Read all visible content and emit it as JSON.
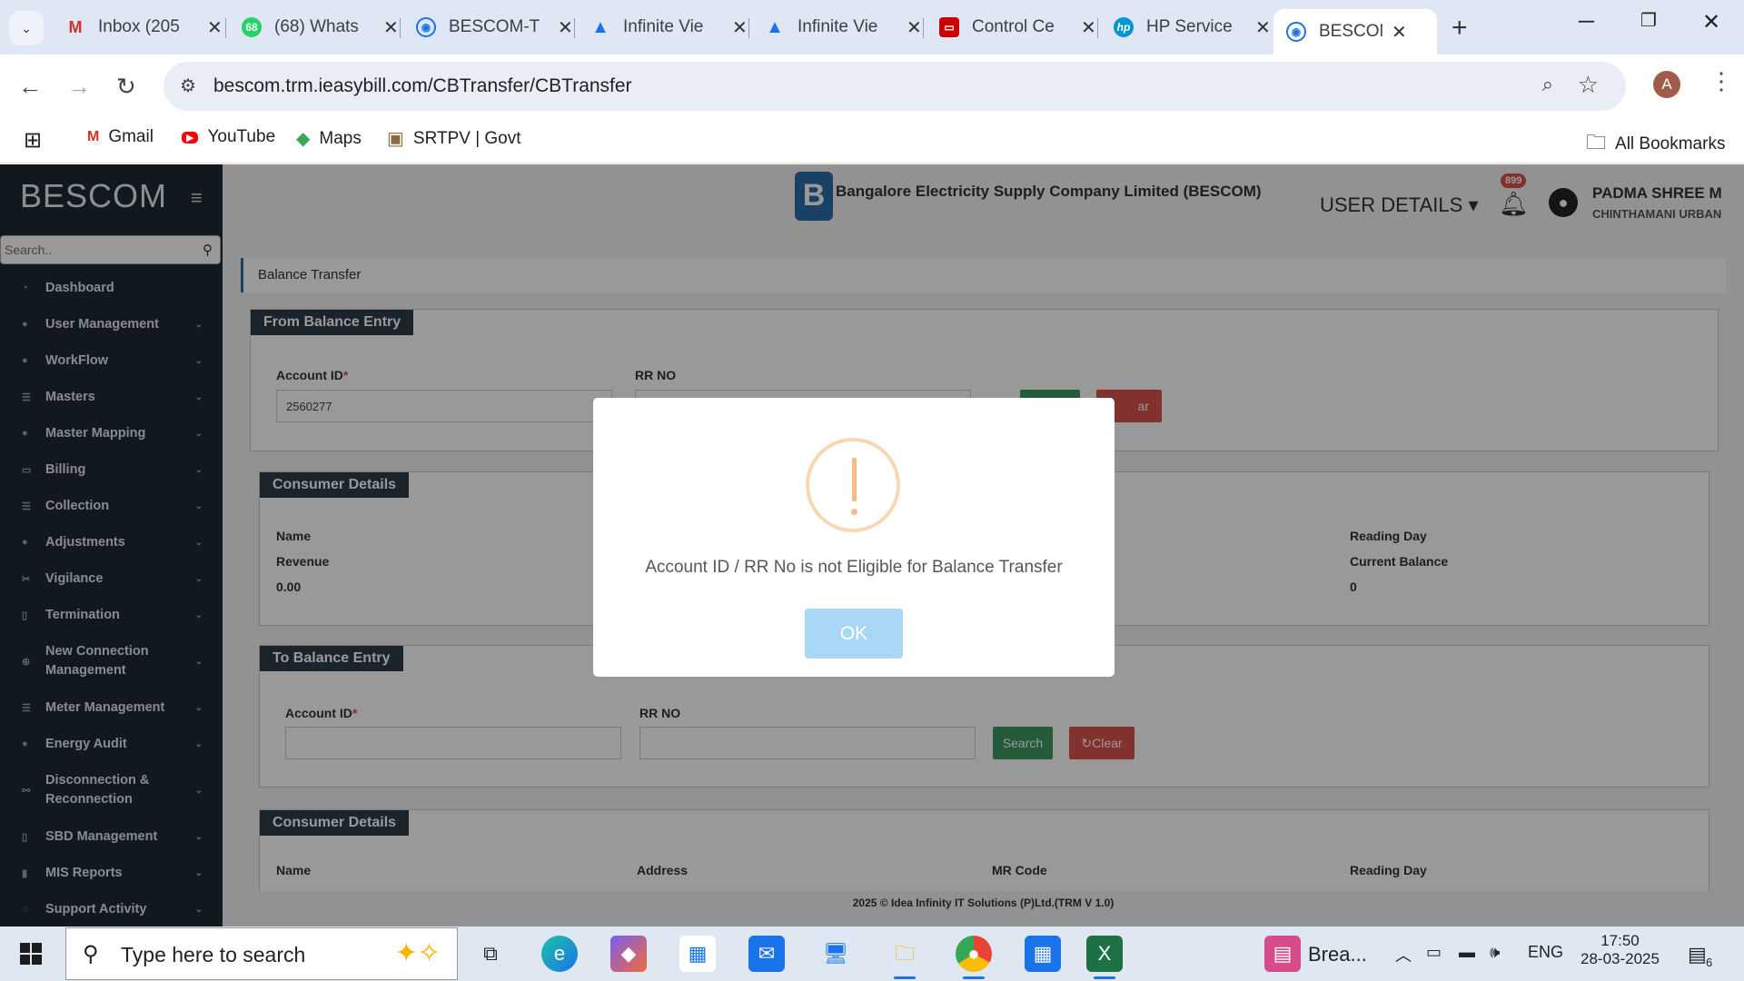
{
  "browser": {
    "tabs": [
      {
        "title": "Inbox (205",
        "icon": "gmail-icon",
        "color": "#d93025"
      },
      {
        "title": "(68) Whats",
        "icon": "whatsapp-icon",
        "color": "#25d366"
      },
      {
        "title": "BESCOM-T",
        "icon": "bescom-icon",
        "color": "#1a73e8"
      },
      {
        "title": "Infinite Vie",
        "icon": "infinite-icon",
        "color": "#1a73e8"
      },
      {
        "title": "Infinite Vie",
        "icon": "infinite-icon",
        "color": "#1a73e8"
      },
      {
        "title": "Control Ce",
        "icon": "control-center-icon",
        "color": "#c00"
      },
      {
        "title": "HP Service",
        "icon": "hp-icon",
        "color": "#0096d6"
      },
      {
        "title": "BESCOM-T",
        "icon": "bescom-icon",
        "color": "#1a73e8"
      }
    ],
    "url": "bescom.trm.ieasybill.com/CBTransfer/CBTransfer",
    "profile_initial": "A",
    "bookmarks": [
      "Gmail",
      "YouTube",
      "Maps",
      "SRTPV | Govt"
    ],
    "all_bookmarks": "All Bookmarks"
  },
  "app": {
    "logo": "BESCOM",
    "search_placeholder": "Search..",
    "menu": [
      "Dashboard",
      "User Management",
      "WorkFlow",
      "Masters",
      "Master Mapping",
      "Billing",
      "Collection",
      "Adjustments",
      "Vigilance",
      "Termination",
      "New Connection Management",
      "Meter Management",
      "Energy Audit",
      "Disconnection & Reconnection",
      "SBD Management",
      "MIS Reports",
      "Support Activity"
    ],
    "company": "Bangalore Electricity Supply Company Limited (BESCOM)",
    "user_details": "USER DETAILS",
    "notifications": "899",
    "user_name": "PADMA SHREE M",
    "user_location": "CHINTHAMANI URBAN",
    "page_title": "Balance Transfer",
    "from_entry": {
      "title": "From Balance Entry",
      "account_label": "Account ID",
      "account_value": "2560277",
      "rr_label": "RR NO",
      "clear_label": "ar"
    },
    "consumer1": {
      "title": "Consumer Details",
      "name_label": "Name",
      "revenue_label": "Revenue",
      "revenue_value": "0.00",
      "reading_day_label": "Reading Day",
      "current_balance_label": "Current Balance",
      "current_balance_value": "0"
    },
    "to_entry": {
      "title": "To Balance Entry",
      "account_label": "Account ID",
      "rr_label": "RR NO",
      "search_label": "Search",
      "clear_label": "Clear"
    },
    "consumer2": {
      "title": "Consumer Details",
      "name_label": "Name",
      "address_label": "Address",
      "mr_code_label": "MR Code",
      "reading_day_label": "Reading Day"
    },
    "footer": "2025 © Idea Infinity IT Solutions (P)Ltd.(TRM V 1.0)"
  },
  "modal": {
    "message": "Account ID / RR No is not Eligible for Balance Transfer",
    "ok_label": "OK"
  },
  "taskbar": {
    "search_placeholder": "Type here to search",
    "breaking_label": "Brea...",
    "lang": "ENG",
    "time": "17:50",
    "date": "28-03-2025",
    "notif_count": "6"
  }
}
